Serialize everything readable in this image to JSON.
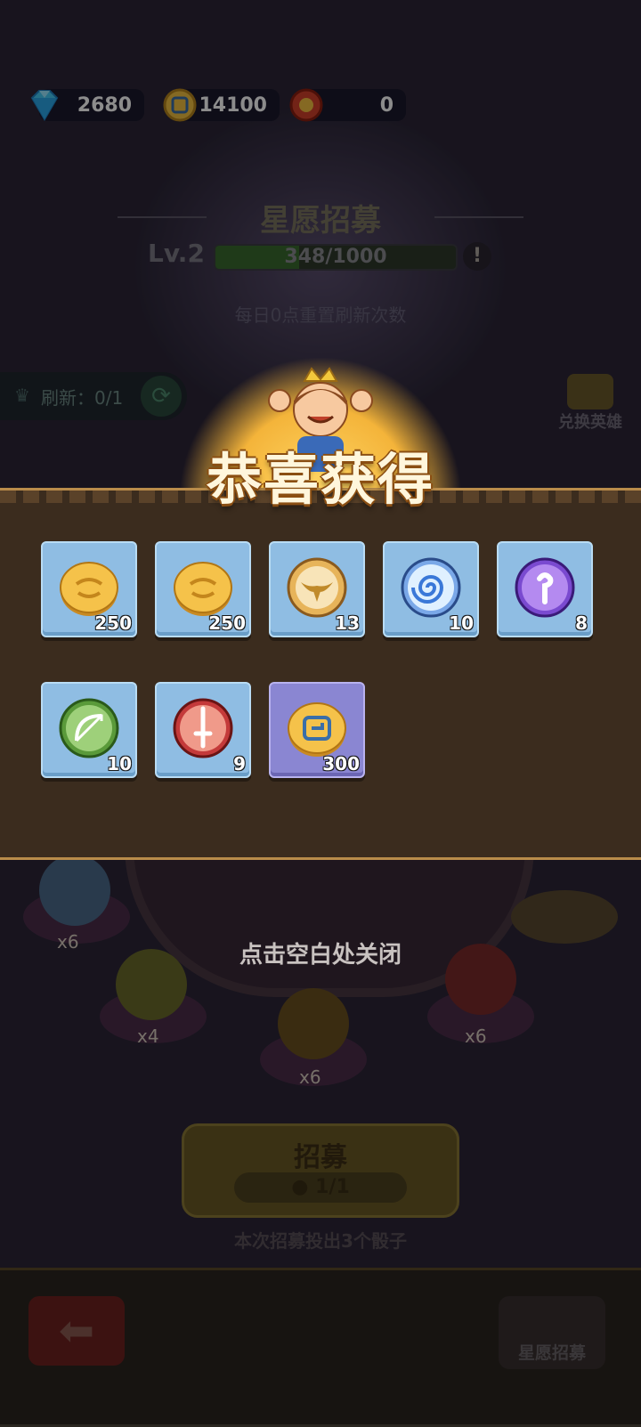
{
  "currency": {
    "gems": {
      "value": "2680",
      "icon": "diamond-icon"
    },
    "gold": {
      "value": "14100",
      "icon": "coin-icon"
    },
    "chips": {
      "value": "0",
      "icon": "red-chip-icon"
    }
  },
  "header": {
    "title": "星愿招募",
    "level": "Lv.2",
    "progress_text": "348/1000",
    "progress_fraction": 0.348,
    "info": "!",
    "reset_note": "每日0点重置刷新次数"
  },
  "refresh": {
    "label": "刷新：0/1"
  },
  "exchange": {
    "label": "兑换英雄"
  },
  "reward": {
    "title": "恭喜获得",
    "items": [
      {
        "icon": "gold-coin-icon",
        "qty": "250"
      },
      {
        "icon": "gold-coin-icon",
        "qty": "250"
      },
      {
        "icon": "wing-emblem-icon",
        "qty": "13"
      },
      {
        "icon": "swirl-orb-icon",
        "qty": "10"
      },
      {
        "icon": "purple-staff-orb-icon",
        "qty": "8"
      },
      {
        "icon": "bow-orb-icon",
        "qty": "10"
      },
      {
        "icon": "sword-orb-icon",
        "qty": "9"
      },
      {
        "icon": "spiral-coin-icon",
        "qty": "300"
      }
    ],
    "close_hint": "点击空白处关闭"
  },
  "board": {
    "multipliers": [
      "x6",
      "x4",
      "x6",
      "x6"
    ]
  },
  "recruit": {
    "label": "招募",
    "count": "1/1",
    "note": "本次招募投出3个骰子"
  },
  "bottom": {
    "back_icon": "back-arrow-icon",
    "wish_label": "星愿招募"
  },
  "colors": {
    "blue_slot": "#8fbde3",
    "purple_slot": "#8a86d2",
    "gold": "#f4b43a"
  }
}
